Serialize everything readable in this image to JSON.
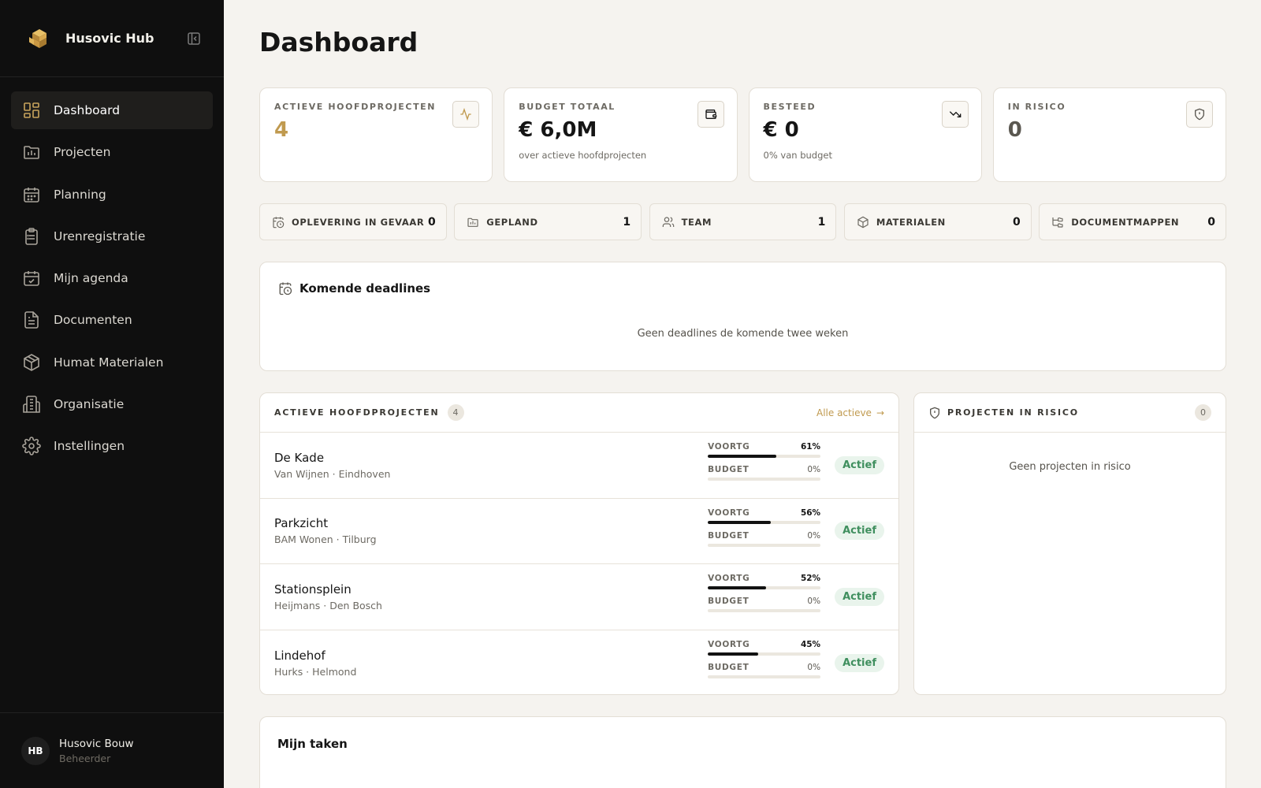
{
  "app": {
    "name": "Husovic Hub"
  },
  "sidebar": {
    "items": [
      {
        "label": "Dashboard",
        "icon": "dashboard-icon",
        "active": true
      },
      {
        "label": "Projecten",
        "icon": "folder-chart-icon"
      },
      {
        "label": "Planning",
        "icon": "calendar-icon"
      },
      {
        "label": "Urenregistratie",
        "icon": "clipboard-list-icon"
      },
      {
        "label": "Mijn agenda",
        "icon": "calendar-check-icon"
      },
      {
        "label": "Documenten",
        "icon": "file-text-icon"
      },
      {
        "label": "Humat Materialen",
        "icon": "package-icon"
      },
      {
        "label": "Organisatie",
        "icon": "building-icon"
      },
      {
        "label": "Instellingen",
        "icon": "settings-icon"
      }
    ],
    "user": {
      "initials": "HB",
      "name": "Husovic Bouw",
      "role": "Beheerder"
    }
  },
  "page": {
    "title": "Dashboard"
  },
  "kpis": [
    {
      "label": "Actieve hoofdprojecten",
      "value": "4",
      "sub": "",
      "icon": "activity-icon"
    },
    {
      "label": "Budget totaal",
      "value": "€ 6,0M",
      "sub": "over actieve hoofdprojecten",
      "icon": "wallet-icon"
    },
    {
      "label": "Besteed",
      "value": "€ 0",
      "sub": "0% van budget",
      "icon": "trending-down-icon"
    },
    {
      "label": "In risico",
      "value": "0",
      "sub": "",
      "icon": "shield-alert-icon"
    }
  ],
  "stats": [
    {
      "label": "OPLEVERING IN GEVAAR",
      "value": "0",
      "icon": "calendar-clock-icon"
    },
    {
      "label": "GEPLAND",
      "value": "1",
      "icon": "folder-chart-icon"
    },
    {
      "label": "TEAM",
      "value": "1",
      "icon": "users-icon"
    },
    {
      "label": "MATERIALEN",
      "value": "0",
      "icon": "package-icon"
    },
    {
      "label": "DOCUMENTMAPPEN",
      "value": "0",
      "icon": "folder-tree-icon"
    }
  ],
  "deadlines": {
    "title": "Komende deadlines",
    "empty": "Geen deadlines de komende twee weken"
  },
  "active_projects": {
    "title": "ACTIEVE HOOFDPROJECTEN",
    "count": "4",
    "link": "Alle actieve",
    "progress_label": "VOORTG",
    "budget_label": "BUDGET",
    "rows": [
      {
        "name": "De Kade",
        "meta": "Van Wijnen · Eindhoven",
        "progress": "61%",
        "progress_value": 61,
        "budget": "0%",
        "budget_value": 0,
        "status": "Actief"
      },
      {
        "name": "Parkzicht",
        "meta": "BAM Wonen · Tilburg",
        "progress": "56%",
        "progress_value": 56,
        "budget": "0%",
        "budget_value": 0,
        "status": "Actief"
      },
      {
        "name": "Stationsplein",
        "meta": "Heijmans · Den Bosch",
        "progress": "52%",
        "progress_value": 52,
        "budget": "0%",
        "budget_value": 0,
        "status": "Actief"
      },
      {
        "name": "Lindehof",
        "meta": "Hurks · Helmond",
        "progress": "45%",
        "progress_value": 45,
        "budget": "0%",
        "budget_value": 0,
        "status": "Actief"
      }
    ]
  },
  "risk": {
    "title": "PROJECTEN IN RISICO",
    "count": "0",
    "empty": "Geen projecten in risico"
  },
  "tasks": {
    "title": "Mijn taken"
  },
  "colors": {
    "accent": "#c09a4f",
    "sidebar": "#0f0f0f",
    "background": "#f5f3ef",
    "status_green": "#3f8f5e"
  }
}
